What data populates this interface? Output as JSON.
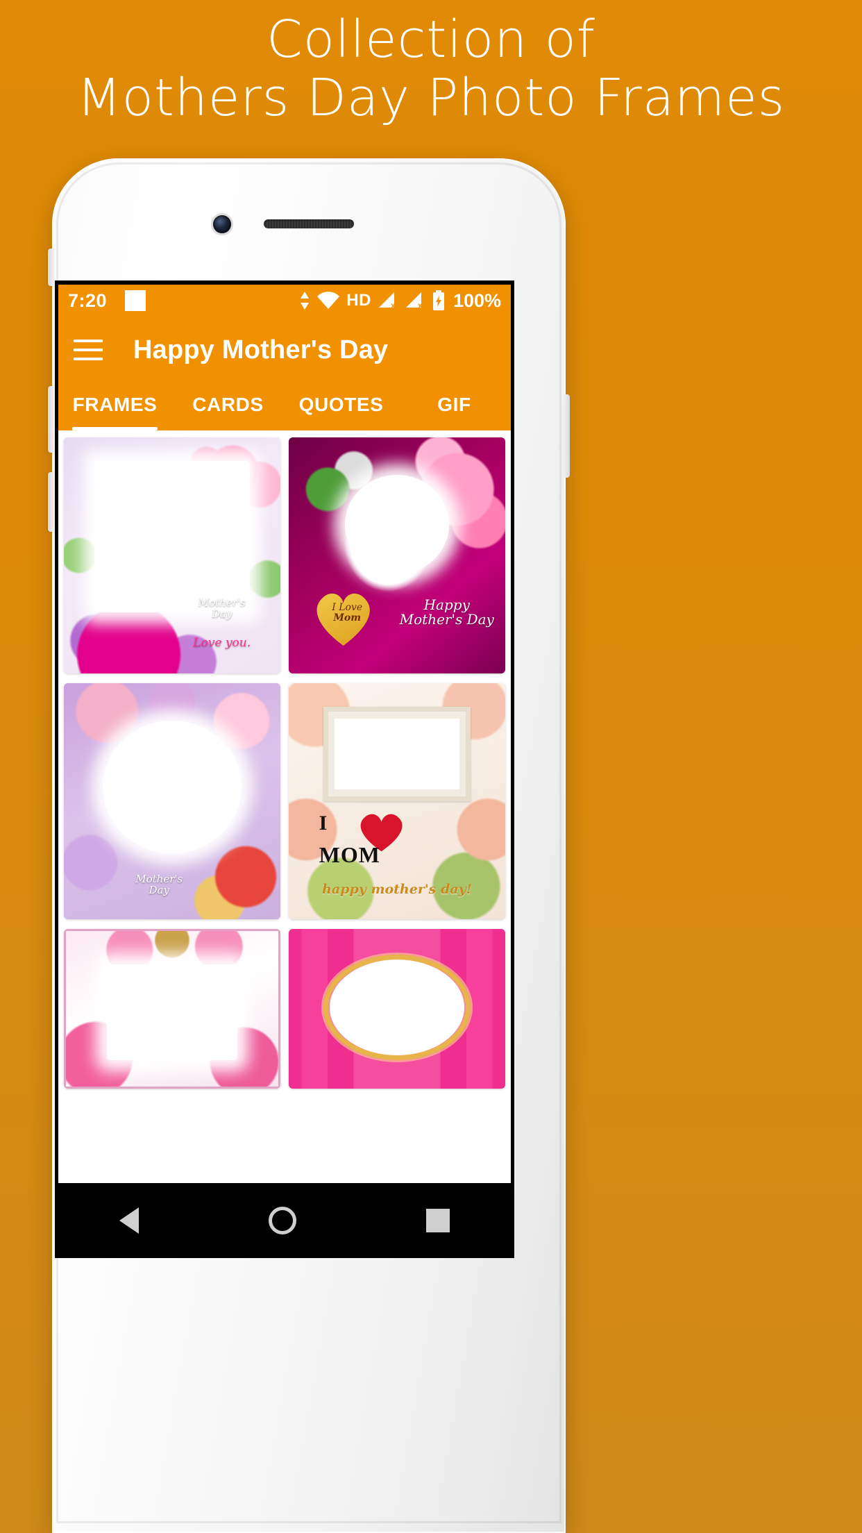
{
  "promo": {
    "line1": "Collection of",
    "line2": "Mothers Day Photo Frames",
    "background_color": "#DE8A0A",
    "text_color": "#FFFFFF"
  },
  "phone": {
    "body_color": "#F5F5F5",
    "icons": {
      "front_camera": "camera-icon",
      "earpiece": "speaker-icon"
    }
  },
  "status_bar": {
    "time": "7:20",
    "notification_placeholder": "",
    "hd_label": "HD",
    "battery_percent": "100%",
    "background_color": "#F29100",
    "icons": [
      "data-transfer-icon",
      "wifi-icon",
      "hd-icon",
      "signal-no-sim-icon",
      "signal-no-sim-icon",
      "battery-charging-icon"
    ]
  },
  "app_bar": {
    "menu_icon": "hamburger-menu-icon",
    "title": "Happy Mother's Day",
    "background_color": "#F29100",
    "title_color": "#FFFFFF"
  },
  "tabs": {
    "active_index": 0,
    "indicator_color": "#FFFFFF",
    "items": [
      {
        "label": "FRAMES"
      },
      {
        "label": "CARDS"
      },
      {
        "label": "QUOTES"
      },
      {
        "label": "GIF"
      }
    ]
  },
  "frames_grid": {
    "items": [
      {
        "id": "frame-1",
        "caption_line1": "Mother's",
        "caption_line2": "Day",
        "caption_line3": "Love you.",
        "style": "pink-roses-gerbera-white-border"
      },
      {
        "id": "frame-2",
        "caption_line1": "I Love",
        "caption_line2": "Mom",
        "caption_line3": "Happy Mother's Day",
        "style": "magenta-heart-lilies-wreath"
      },
      {
        "id": "frame-3",
        "caption_line1": "Mother's",
        "caption_line2": "Day",
        "caption_line3": "",
        "style": "pastel-pearl-blossoms-oval"
      },
      {
        "id": "frame-4",
        "caption_line1": "I",
        "caption_line2": "MOM",
        "caption_line3": "happy mother's day!",
        "style": "peach-roses-ivory-frame"
      },
      {
        "id": "frame-5",
        "caption_line1": "",
        "caption_line2": "",
        "caption_line3": "",
        "style": "pink-roses-gold-vines"
      },
      {
        "id": "frame-6",
        "caption_line1": "",
        "caption_line2": "",
        "caption_line3": "",
        "style": "hot-pink-gold-oval-frame"
      }
    ]
  },
  "nav_bar": {
    "background_color": "#000000",
    "buttons": [
      {
        "name": "back-button",
        "icon": "triangle-back-icon"
      },
      {
        "name": "home-button",
        "icon": "circle-home-icon"
      },
      {
        "name": "recents-button",
        "icon": "square-recents-icon"
      }
    ]
  }
}
